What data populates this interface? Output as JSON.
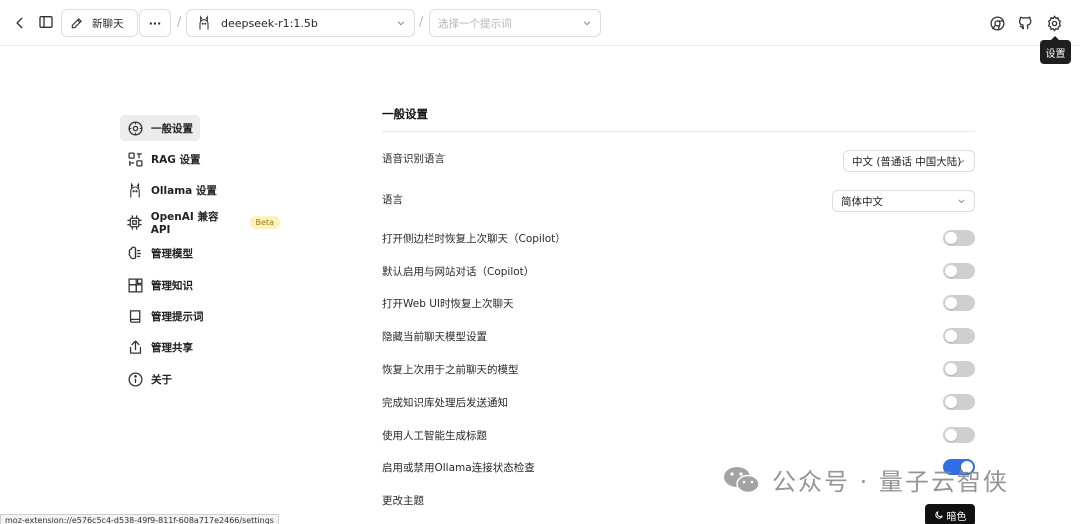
{
  "header": {
    "new_chat_label": "新聊天",
    "more_label": "···",
    "separator": "/",
    "model_name": "deepseek-r1:1.5b",
    "prompt_placeholder": "选择一个提示词",
    "settings_tooltip": "设置"
  },
  "sidebar": {
    "items": [
      {
        "label": "一般设置",
        "icon": "settings-icon",
        "active": true
      },
      {
        "label": "RAG 设置",
        "icon": "rag-icon"
      },
      {
        "label": "Ollama 设置",
        "icon": "ollama-icon"
      },
      {
        "label": "OpenAI 兼容 API",
        "icon": "chip-icon",
        "badge": "Beta"
      },
      {
        "label": "管理模型",
        "icon": "brain-icon"
      },
      {
        "label": "管理知识",
        "icon": "blocks-icon"
      },
      {
        "label": "管理提示词",
        "icon": "book-icon"
      },
      {
        "label": "管理共享",
        "icon": "share-icon"
      },
      {
        "label": "关于",
        "icon": "info-icon"
      }
    ]
  },
  "main": {
    "title": "一般设置",
    "speech_language_label": "语音识别语言",
    "speech_language_value": "中文 (普通话 中国大陆)",
    "language_label": "语言",
    "language_value": "简体中文",
    "toggles": [
      {
        "label": "打开侧边栏时恢复上次聊天（Copilot）",
        "on": false
      },
      {
        "label": "默认启用与网站对话（Copilot）",
        "on": false
      },
      {
        "label": "打开Web UI时恢复上次聊天",
        "on": false
      },
      {
        "label": "隐藏当前聊天模型设置",
        "on": false
      },
      {
        "label": "恢复上次用于之前聊天的模型",
        "on": false
      },
      {
        "label": "完成知识库处理后发送通知",
        "on": false
      },
      {
        "label": "使用人工智能生成标题",
        "on": false
      },
      {
        "label": "启用或禁用Ollama连接状态检查",
        "on": true
      }
    ],
    "theme_label": "更改主题",
    "dark_button_label": "暗色"
  },
  "statusbar": "moz-extension://e576c5c4-d538-49f9-811f-608a717e2466/settings",
  "watermark": "公众号 · 量子云智侠",
  "colors": {
    "accent": "#2f6fe5",
    "toggle_off": "#cfcfcf"
  }
}
